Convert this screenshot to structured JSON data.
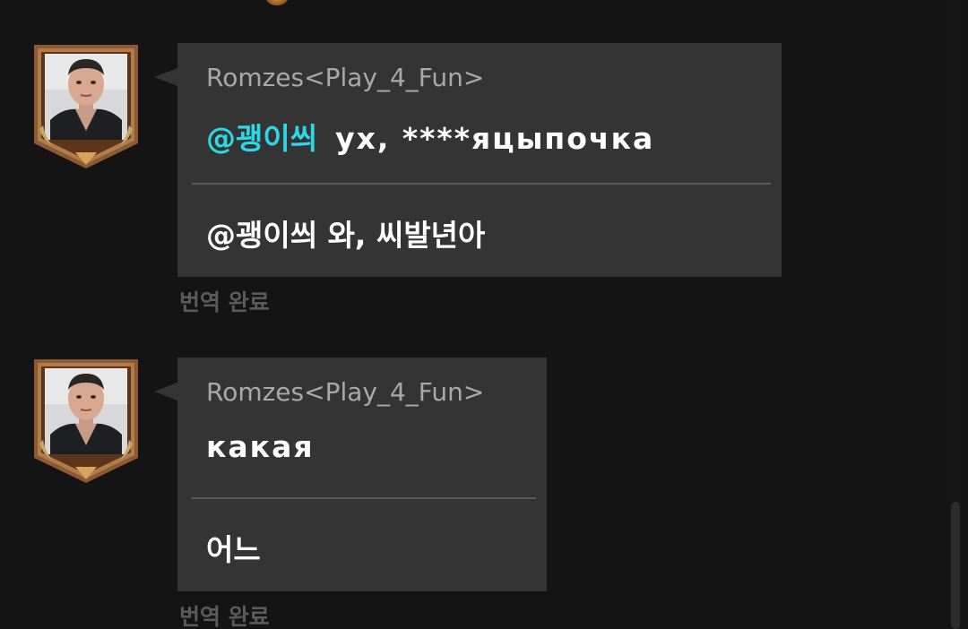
{
  "messages": [
    {
      "sender": "Romzes<Play_4_Fun>",
      "mention": "@괭이씌",
      "original_text": "ух, ****яцыпочка",
      "translation": "@괭이씌 와, 씨발년아",
      "status": "번역 완료"
    },
    {
      "sender": "Romzes<Play_4_Fun>",
      "mention": "",
      "original_text": "какая",
      "translation": "어느",
      "status": "번역 완료"
    }
  ],
  "icons": {
    "avatar": "user-avatar-portrait",
    "frame": "rank-badge-frame-icon",
    "top_emblem": "emblem-icon"
  },
  "colors": {
    "background": "#141414",
    "bubble": "#343434",
    "mention": "#2fd6e6",
    "sender": "#a9a9a9",
    "status": "#5a5a5a",
    "frame": "#8b5a34"
  }
}
